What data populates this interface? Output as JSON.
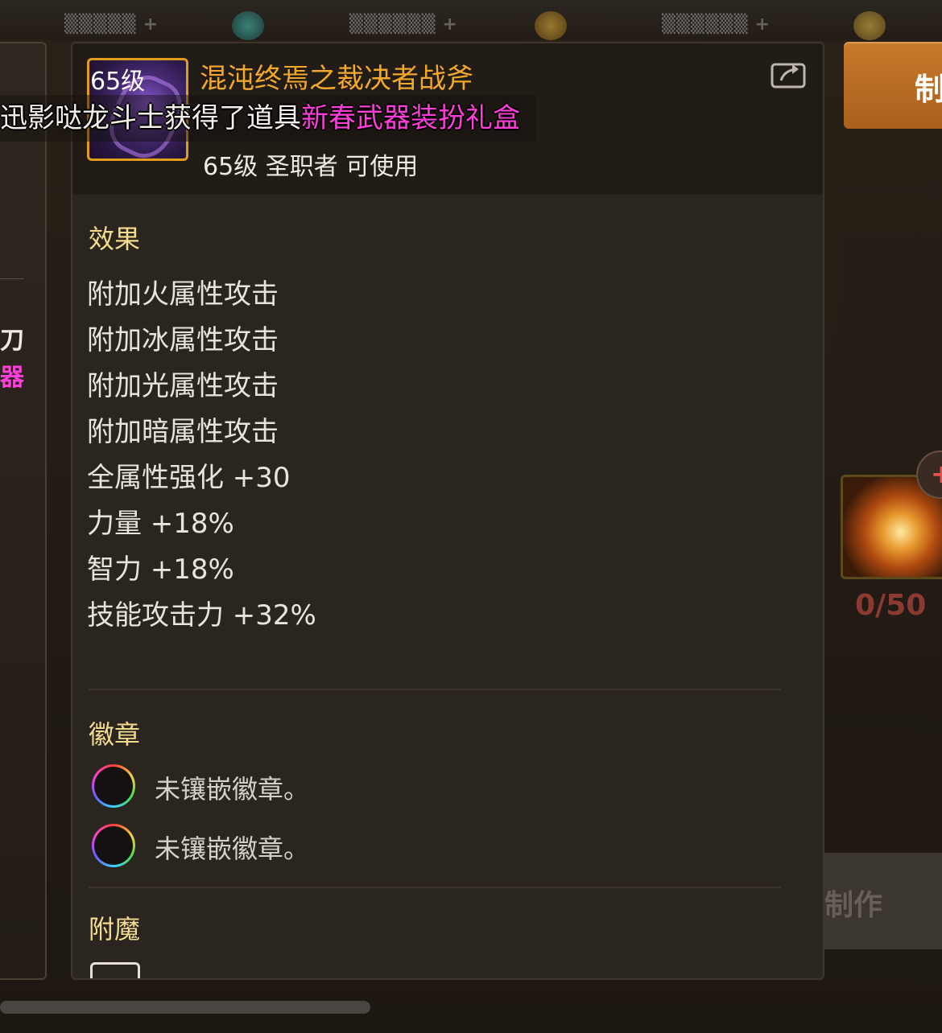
{
  "tooltip": {
    "item_level_badge": "65级",
    "item_name": "混沌终焉之裁决者战斧",
    "requirement": "65级 圣职者 可使用",
    "effects_title": "效果",
    "effects": [
      "附加火属性攻击",
      "附加冰属性攻击",
      "附加光属性攻击",
      "附加暗属性攻击",
      "全属性强化 +30",
      "力量 +18%",
      "智力 +18%",
      "技能攻击力 +32%"
    ],
    "badges_title": "徽章",
    "badge_slots": [
      "未镶嵌徽章。",
      "未镶嵌徽章。"
    ],
    "enchant_title": "附魔"
  },
  "broadcast": {
    "prefix": "迅影哒龙斗士获得了道具",
    "item": "新春武器装扮礼盒"
  },
  "background": {
    "left_glyph_1": "刀",
    "left_glyph_2": "器",
    "craft_button_label": "制",
    "item_count": "0/50",
    "badge_plus": "+",
    "bottom_button_label": "制作"
  },
  "colors": {
    "item_name": "#f2a82a",
    "section_title": "#f3dc8f",
    "broadcast_highlight": "#ff3fd9",
    "icon_border": "#e39b1c"
  }
}
